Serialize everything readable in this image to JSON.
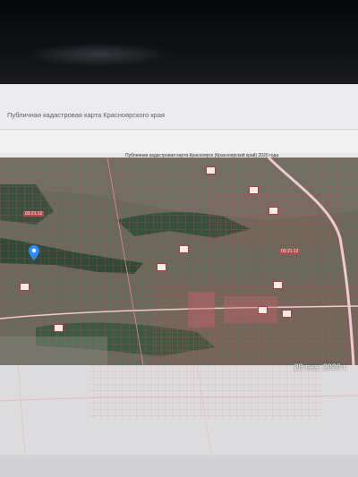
{
  "page": {
    "title": "Публичная кадастровая карта Красноярского края",
    "map_caption": "Публичная кадастровая карта Красноярск (Красноярский край) 2020 года"
  },
  "map": {
    "quarter_labels": [
      "03:21:12",
      "03:21:12"
    ],
    "pin_icon": "location-pin-icon"
  },
  "photo": {
    "date_stamp": "28 янв. 2020 г."
  },
  "colors": {
    "parcel_border": "#e0404a",
    "road": "#f2c9cf",
    "header_bg": "#ececee",
    "pin": "#2d8cff"
  }
}
